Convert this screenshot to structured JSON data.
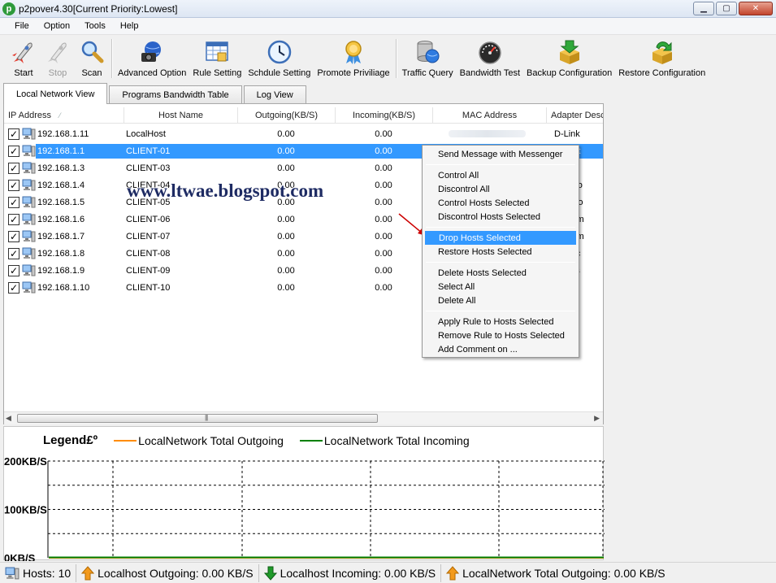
{
  "window": {
    "title": "p2pover4.30[Current Priority:Lowest]",
    "app_icon": "p2pover-icon",
    "controls": [
      "minimize",
      "maximize",
      "close"
    ]
  },
  "menubar": [
    "File",
    "Option",
    "Tools",
    "Help"
  ],
  "toolbar": [
    {
      "label": "Start",
      "icon": "rocket-icon",
      "enabled": true
    },
    {
      "label": "Stop",
      "icon": "rocket-gray-icon",
      "enabled": false
    },
    {
      "label": "Scan",
      "icon": "magnifier-icon",
      "enabled": true
    },
    {
      "label": "Advanced Option",
      "icon": "camera-globe-icon",
      "enabled": true
    },
    {
      "label": "Rule Setting",
      "icon": "spreadsheet-icon",
      "enabled": true
    },
    {
      "label": "Schdule Setting",
      "icon": "clock-icon",
      "enabled": true
    },
    {
      "label": "Promote Priviliage",
      "icon": "medal-icon",
      "enabled": true
    },
    {
      "label": "Traffic Query",
      "icon": "database-globe-icon",
      "enabled": true
    },
    {
      "label": "Bandwidth Test",
      "icon": "speedometer-icon",
      "enabled": true
    },
    {
      "label": "Backup Configuration",
      "icon": "box-download-icon",
      "enabled": true
    },
    {
      "label": "Restore Configuration",
      "icon": "box-upload-icon",
      "enabled": true
    }
  ],
  "tabs": [
    {
      "label": "Local Network View",
      "active": true
    },
    {
      "label": "Programs Bandwidth Table",
      "active": false
    },
    {
      "label": "Log View",
      "active": false
    }
  ],
  "list": {
    "columns": [
      "IP Address",
      "Host Name",
      "Outgoing(KB/S)",
      "Incoming(KB/S)",
      "MAC Address",
      "Adapter Desc"
    ],
    "rows": [
      {
        "ip": "192.168.1.11",
        "host": "LocalHost",
        "out": "0.00",
        "in": "0.00",
        "adapter": "D-Link",
        "checked": true,
        "selected": false
      },
      {
        "ip": "192.168.1.1",
        "host": "CLIENT-01",
        "out": "0.00",
        "in": "0.00",
        "adapter": "t Initiat",
        "checked": true,
        "selected": true
      },
      {
        "ip": "192.168.1.3",
        "host": "CLIENT-03",
        "out": "0.00",
        "in": "0.00",
        "adapter": "ng Ele",
        "checked": true,
        "selected": false
      },
      {
        "ip": "192.168.1.4",
        "host": "CLIENT-04",
        "out": "0.00",
        "in": "0.00",
        "adapter": "ck Inco",
        "checked": true,
        "selected": false
      },
      {
        "ip": "192.168.1.5",
        "host": "CLIENT-05",
        "out": "0.00",
        "in": "0.00",
        "adapter": "oup Co",
        "checked": true,
        "selected": false
      },
      {
        "ip": "192.168.1.6",
        "host": "CLIENT-06",
        "out": "0.00",
        "in": "0.00",
        "adapter": "System",
        "checked": true,
        "selected": false
      },
      {
        "ip": "192.168.1.7",
        "host": "CLIENT-07",
        "out": "0.00",
        "in": "0.00",
        "adapter": "System",
        "checked": true,
        "selected": false
      },
      {
        "ip": "192.168.1.8",
        "host": "CLIENT-08",
        "out": "0.00",
        "in": "0.00",
        "adapter": "on Tec",
        "checked": true,
        "selected": false
      },
      {
        "ip": "192.168.1.9",
        "host": "CLIENT-09",
        "out": "0.00",
        "in": "0.00",
        "adapter": "crosys",
        "checked": true,
        "selected": false
      },
      {
        "ip": "192.168.1.10",
        "host": "CLIENT-10",
        "out": "0.00",
        "in": "0.00",
        "adapter": "k Inco",
        "checked": true,
        "selected": false
      }
    ]
  },
  "watermark": "www.ltwae.blogspot.com",
  "context_menu": [
    {
      "label": "Send Message with Messenger"
    },
    {
      "separator": true
    },
    {
      "label": "Control All"
    },
    {
      "label": "Discontrol All"
    },
    {
      "label": "Control Hosts Selected"
    },
    {
      "label": "Discontrol Hosts Selected"
    },
    {
      "separator": true
    },
    {
      "label": "Drop Hosts Selected",
      "active": true
    },
    {
      "label": "Restore Hosts Selected"
    },
    {
      "separator": true
    },
    {
      "label": "Delete Hosts Selected"
    },
    {
      "label": "Select All"
    },
    {
      "label": "Delete All"
    },
    {
      "separator": true
    },
    {
      "label": "Apply Rule to Hosts Selected"
    },
    {
      "label": "Remove Rule to Hosts Selected"
    },
    {
      "label": "Add Comment on ..."
    }
  ],
  "chart_data": {
    "type": "line",
    "legend_title": "Legend£º",
    "series": [
      {
        "name": "LocalNetwork Total Outgoing",
        "color": "#ff8c00",
        "values": [
          0,
          0,
          0,
          0,
          0
        ]
      },
      {
        "name": "LocalNetwork Total Incoming",
        "color": "#008000",
        "values": [
          0,
          0,
          0,
          0,
          0
        ]
      }
    ],
    "y_ticks": [
      "200KB/S",
      "100KB/S",
      "0KB/S"
    ],
    "ylim": [
      0,
      200
    ],
    "grid": true
  },
  "statusbar": {
    "hosts": "Hosts:  10",
    "localhost_out": "Localhost Outgoing:  0.00 KB/S",
    "localhost_in": "Localhost Incoming:  0.00 KB/S",
    "network_out": "LocalNetwork Total Outgoing:  0.00 KB/S"
  },
  "colors": {
    "selection": "#3399ff",
    "outgoing": "#ff8c00",
    "incoming": "#008000",
    "annotation_arrow": "#cc0000"
  }
}
